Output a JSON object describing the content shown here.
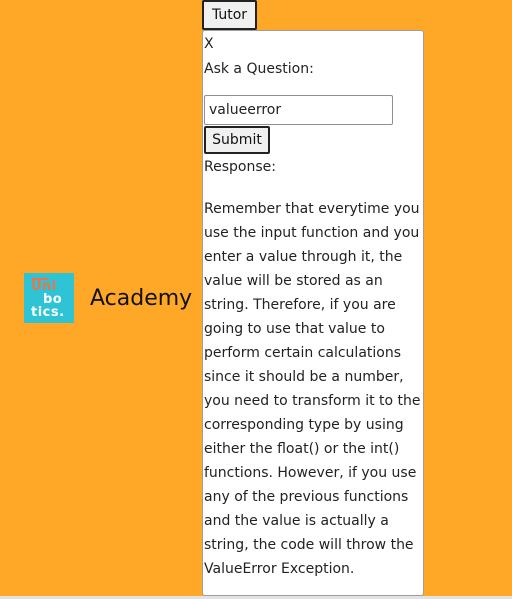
{
  "brand": {
    "logo": {
      "line1": "Uni",
      "line2": "bo",
      "line3": "tics."
    },
    "name": "Academy"
  },
  "tutor": {
    "toggle_label": "Tutor",
    "close_label": "X",
    "ask_label": "Ask a Question:",
    "question_value": "valueerror",
    "submit_label": "Submit",
    "response_label": "Response:",
    "response_text": "Remember that everytime you use the input function and you enter a value through it, the value will be stored as an string. Therefore, if you are going to use that value to perform certain calculations since it should be a number, you need to transform it to the corresponding type by using either the float() or the int() functions. However, if you use any of the previous functions and the value is actually a string, the code will throw the ValueError Exception."
  },
  "colors": {
    "background": "#ffa726",
    "logo_bg": "#2ec4d6",
    "logo_accent": "#e8764a"
  }
}
